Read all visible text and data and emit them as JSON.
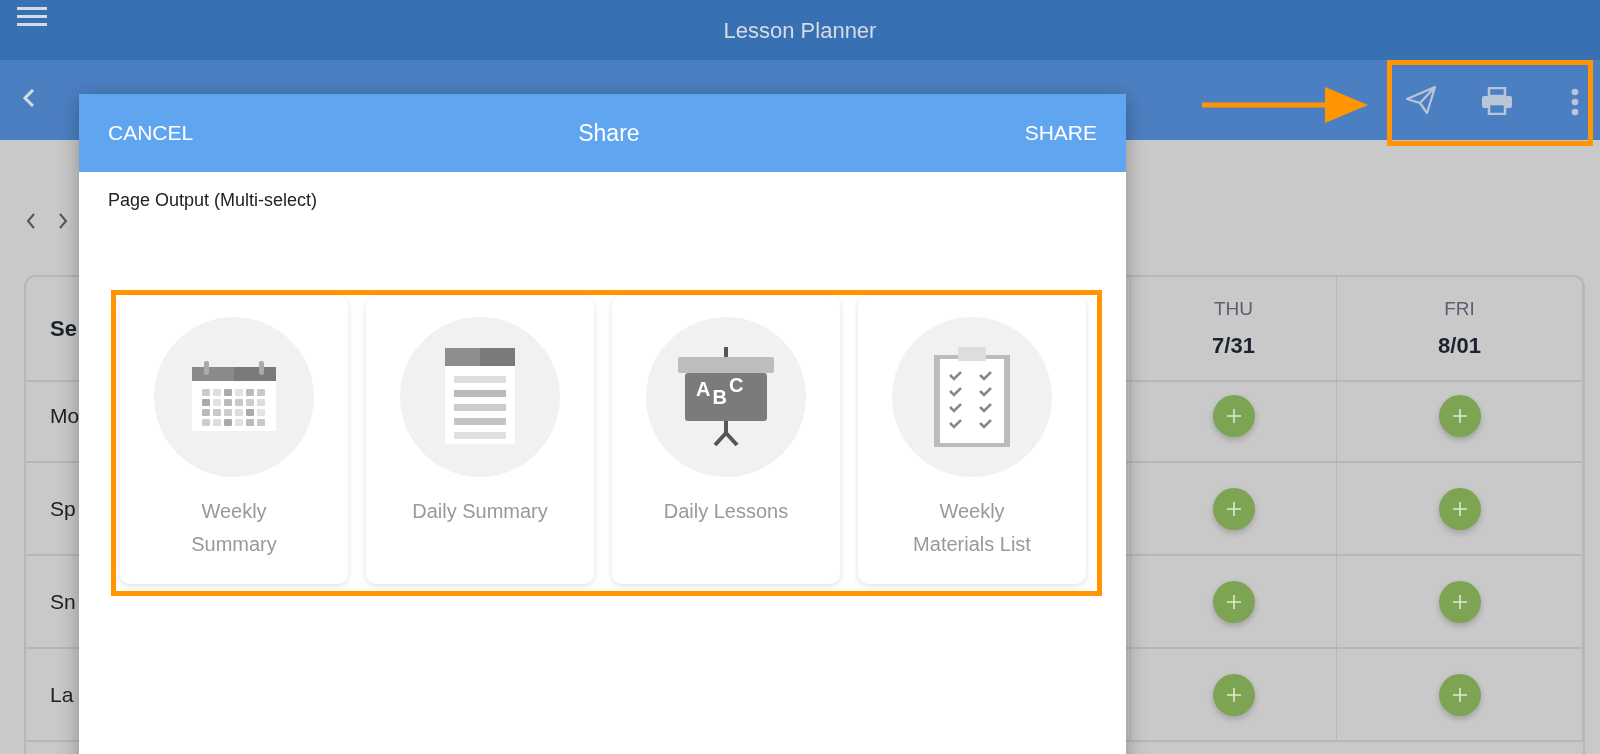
{
  "app_bar": {
    "title": "Lesson Planner"
  },
  "table": {
    "columns": [
      {
        "date": "Se"
      },
      {
        "day": "THU",
        "date": "7/31"
      },
      {
        "day": "FRI",
        "date": "8/01"
      }
    ],
    "rows": [
      {
        "label": "Mo"
      },
      {
        "label": "Sp"
      },
      {
        "label": "Sn"
      },
      {
        "label": "La"
      }
    ]
  },
  "dialog": {
    "cancel": "CANCEL",
    "title": "Share",
    "confirm": "SHARE",
    "section_label": "Page Output (Multi-select)",
    "options": [
      {
        "kind": "calendar",
        "label": "Weekly\nSummary"
      },
      {
        "kind": "document",
        "label": "Daily Summary"
      },
      {
        "kind": "easel",
        "label": "Daily Lessons",
        "board_text": "ABC"
      },
      {
        "kind": "checklist",
        "label": "Weekly\nMaterials List"
      }
    ]
  }
}
